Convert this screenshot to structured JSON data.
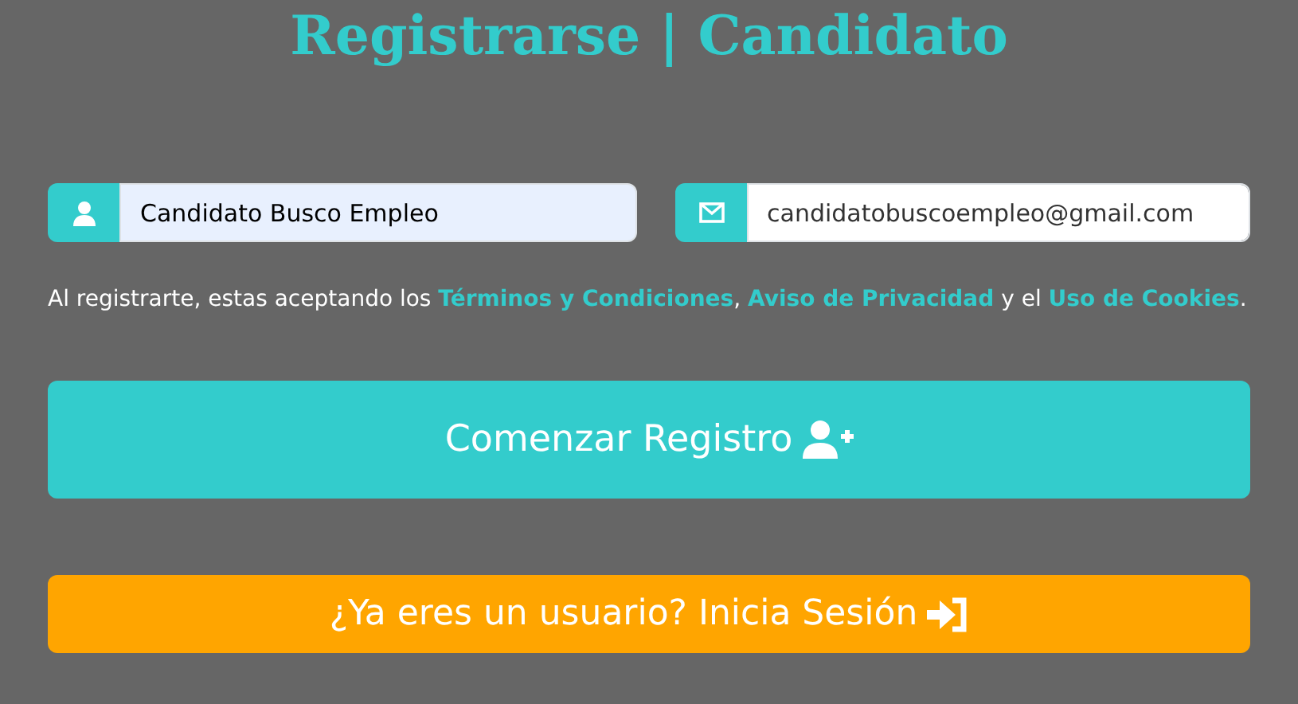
{
  "title": "Registrarse | Candidato",
  "fields": [
    {
      "kind": "name",
      "value": "Candidato Busco Empleo",
      "autofilled": true
    },
    {
      "kind": "email",
      "value": "candidatobuscoempleo@gmail.com",
      "autofilled": false
    }
  ],
  "terms": {
    "lead": "Al registrarte, estas aceptando los ",
    "links": [
      {
        "text": "Términos y Condiciones",
        "after": ", "
      },
      {
        "text": "Aviso de Privacidad",
        "after": " y el "
      },
      {
        "text": "Uso de Cookies",
        "after": "."
      }
    ]
  },
  "buttons": [
    {
      "kind": "register",
      "label": "Comenzar Registro"
    },
    {
      "kind": "login",
      "label": "¿Ya eres un usuario? Inicia Sesión"
    }
  ]
}
